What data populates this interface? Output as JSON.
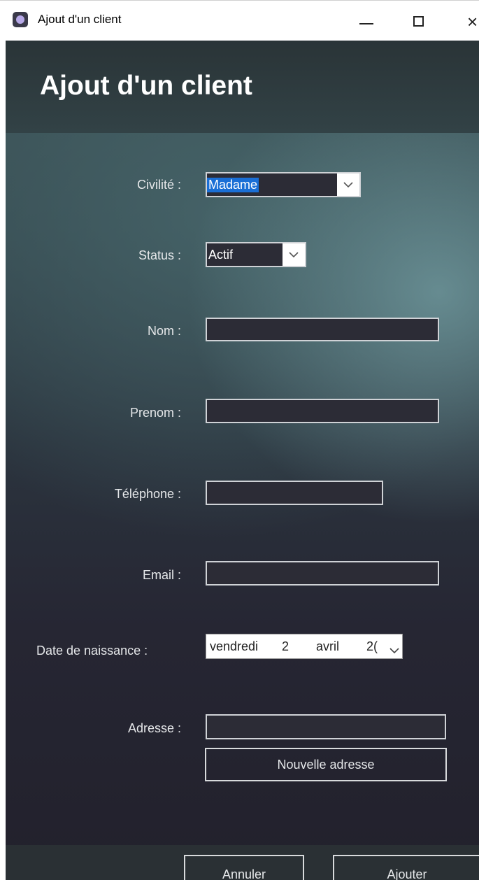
{
  "window": {
    "title": "Ajout d'un client"
  },
  "icons": {
    "app": "app-icon",
    "minimize": "minimize-icon",
    "maximize": "maximize-icon",
    "close": "close-icon",
    "dropdown": "chevron-down-icon"
  },
  "page": {
    "title": "Ajout d'un client"
  },
  "form": {
    "civilite": {
      "label": "Civilité :",
      "value": "Madame"
    },
    "status": {
      "label": "Status :",
      "value": "Actif"
    },
    "nom": {
      "label": "Nom :",
      "value": ""
    },
    "prenom": {
      "label": "Prenom :",
      "value": ""
    },
    "telephone": {
      "label": "Téléphone :",
      "value": ""
    },
    "email": {
      "label": "Email :",
      "value": ""
    },
    "date_naissance": {
      "label": "Date de naissance :",
      "weekday": "vendredi",
      "day": "2",
      "month": "avril",
      "year": "2("
    },
    "adresse": {
      "label": "Adresse :",
      "value": ""
    },
    "nouvelle_adresse": "Nouvelle adresse"
  },
  "footer": {
    "cancel": "Annuler",
    "add": "Ajouter"
  },
  "colors": {
    "accent_selection": "#1a6fd6",
    "field_bg": "#2c2c36",
    "header_bg": "#2a3437"
  }
}
